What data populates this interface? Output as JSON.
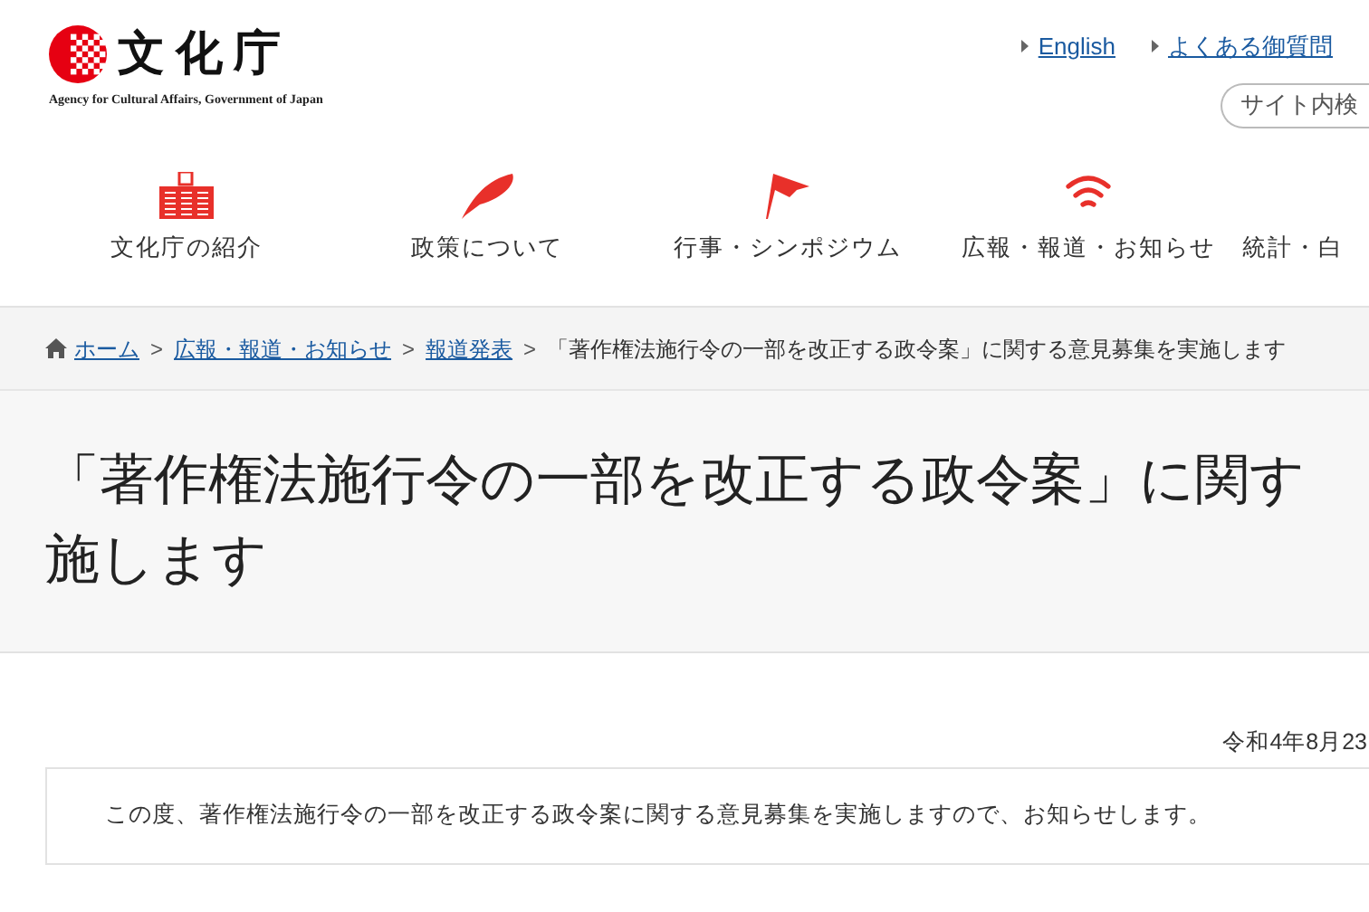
{
  "logo": {
    "name": "文化庁",
    "subtitle": "Agency for Cultural Affairs, Government of Japan"
  },
  "top_links": [
    {
      "label": "English"
    },
    {
      "label": "よくある御質問"
    }
  ],
  "search": {
    "placeholder": "サイト内検"
  },
  "nav": [
    {
      "label": "文化庁の紹介",
      "kind": "building"
    },
    {
      "label": "政策について",
      "kind": "feather"
    },
    {
      "label": "行事・シンポジウム",
      "kind": "flag"
    },
    {
      "label": "広報・報道・お知らせ",
      "kind": "signal"
    },
    {
      "label": "統計・白",
      "kind": "none"
    }
  ],
  "breadcrumb": [
    {
      "label": "ホーム",
      "kind": "link"
    },
    {
      "label": "広報・報道・お知らせ",
      "kind": "link"
    },
    {
      "label": "報道発表",
      "kind": "link"
    },
    {
      "label": "「著作権法施行令の一部を改正する政令案」に関する意見募集を実施します",
      "kind": "current"
    }
  ],
  "separator": ">",
  "title_lines": [
    "「著作権法施行令の一部を改正する政令案」に関す",
    "施します"
  ],
  "date": "令和4年8月23",
  "notice": "この度、著作権法施行令の一部を改正する政令案に関する意見募集を実施しますので、お知らせします。"
}
